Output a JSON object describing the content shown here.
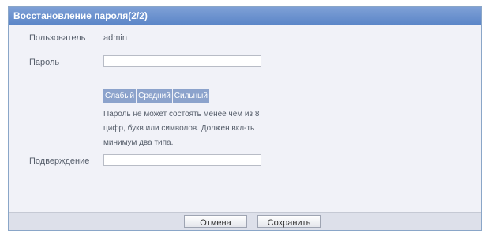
{
  "dialog": {
    "title": "Восстановление пароля(2/2)"
  },
  "form": {
    "user_label": "Пользователь",
    "user_value": "admin",
    "password_label": "Пароль",
    "password_value": "",
    "strength": [
      "Слабый",
      "Средний",
      "Сильный"
    ],
    "hint_lines": [
      "Пароль не может состоять менее чем из 8",
      "цифр, букв или символов. Должен вкл-ть",
      "минимум два типа."
    ],
    "confirm_label": "Подверждение",
    "confirm_value": ""
  },
  "buttons": {
    "cancel": "Отмена",
    "save": "Сохранить"
  }
}
